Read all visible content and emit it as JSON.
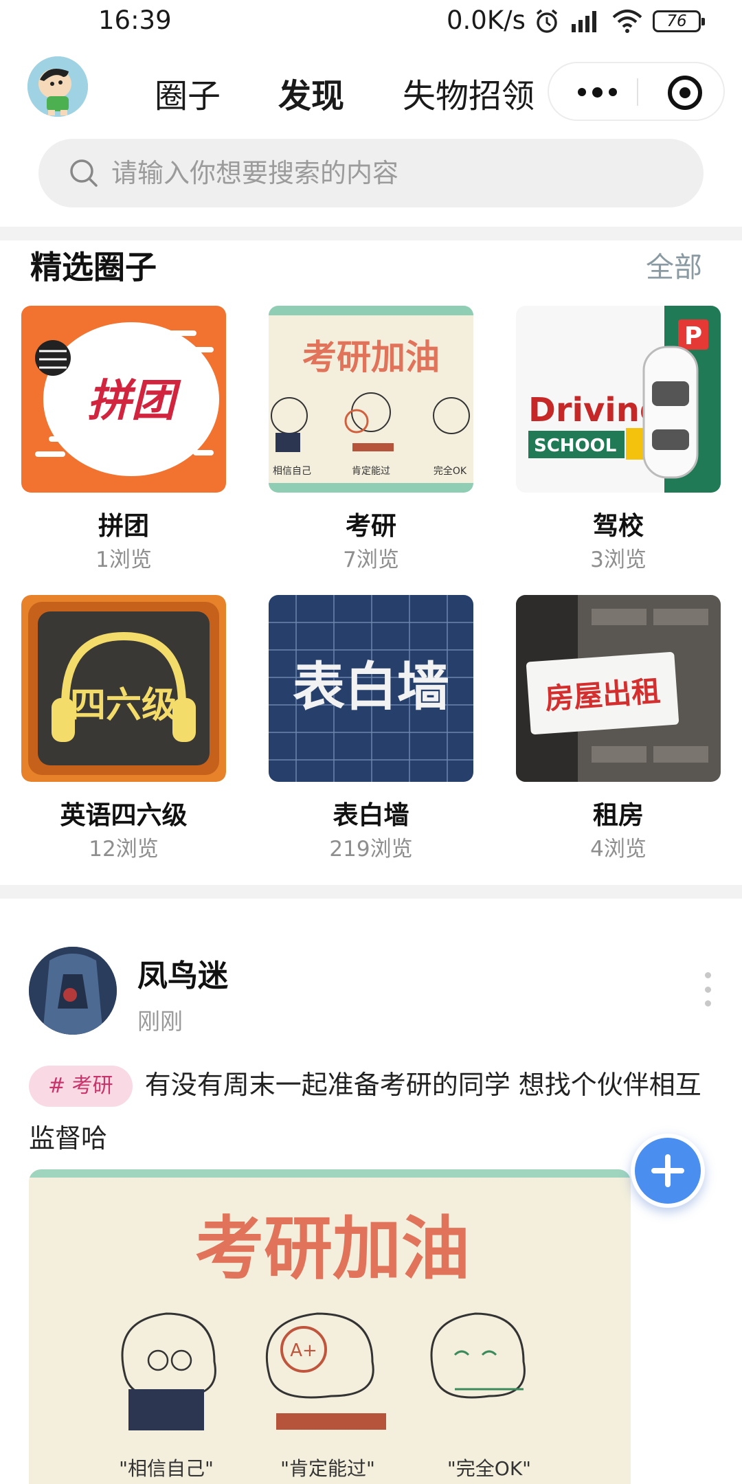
{
  "status_bar": {
    "time": "16:39",
    "network_speed": "0.0K/s",
    "battery": "76"
  },
  "nav": {
    "tabs": [
      {
        "label": "圈子",
        "active": false
      },
      {
        "label": "发现",
        "active": true
      },
      {
        "label": "失物招领",
        "active": false
      }
    ]
  },
  "search": {
    "placeholder": "请输入你想要搜索的内容"
  },
  "featured": {
    "title": "精选圈子",
    "all_label": "全部",
    "circles": [
      {
        "name": "拼团",
        "views": "1浏览",
        "image_text": "拼团"
      },
      {
        "name": "考研",
        "views": "7浏览",
        "image_text": "考研加油",
        "captions": [
          "相信自己",
          "肯定能过",
          "完全OK"
        ]
      },
      {
        "name": "驾校",
        "views": "3浏览",
        "image_text": "Driving",
        "image_subtext": "SCHOOL",
        "sign": "P"
      },
      {
        "name": "英语四六级",
        "views": "12浏览",
        "image_text": "四六级"
      },
      {
        "name": "表白墙",
        "views": "219浏览",
        "image_text": "表白墙"
      },
      {
        "name": "租房",
        "views": "4浏览",
        "image_text": "房屋出租"
      }
    ]
  },
  "post": {
    "username": "凤鸟迷",
    "time": "刚刚",
    "tag": "# 考研",
    "content": "有没有周末一起准备考研的同学 想找个伙伴相互监督哈",
    "image": {
      "title": "考研加油",
      "captions": [
        "\"相信自己\"",
        "\"肯定能过\"",
        "\"完全OK\""
      ]
    }
  },
  "colors": {
    "accent_blue": "#4a8ef0",
    "tag_bg": "#f9d9e4",
    "tag_text": "#c8336a",
    "kaoyan_title": "#e0735a"
  }
}
